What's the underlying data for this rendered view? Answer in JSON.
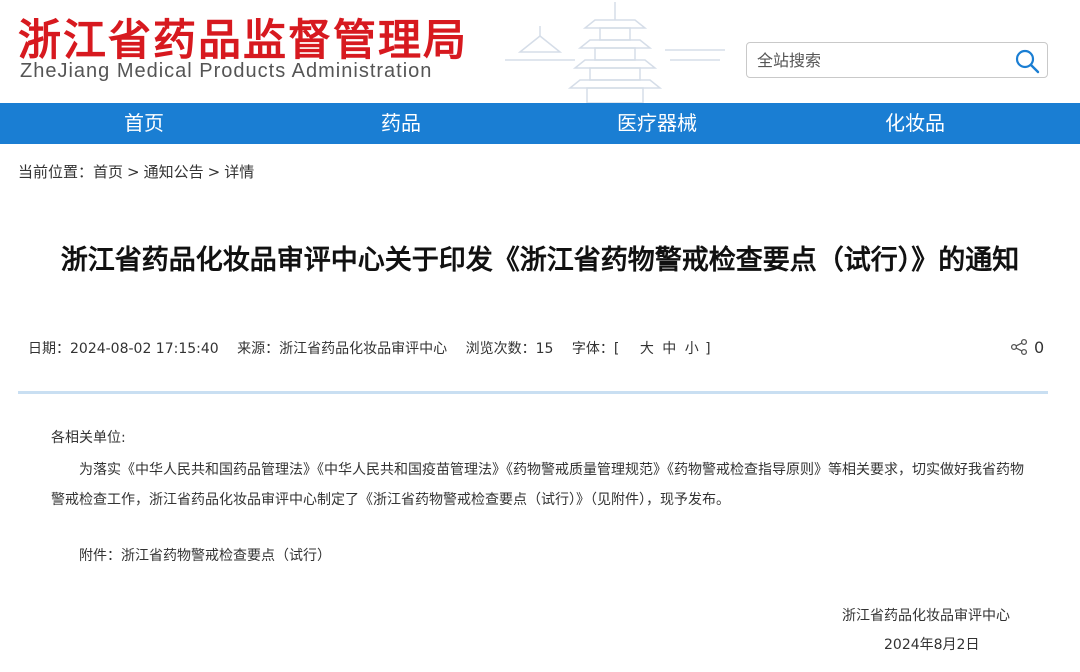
{
  "header": {
    "logo_cn": "浙江省药品监督管理局",
    "logo_en": "ZheJiang Medical Products Administration",
    "search_placeholder": "全站搜索"
  },
  "nav": {
    "items": [
      {
        "label": "首页"
      },
      {
        "label": "药品"
      },
      {
        "label": "医疗器械"
      },
      {
        "label": "化妆品"
      }
    ]
  },
  "breadcrumb": {
    "prefix": "当前位置：",
    "items": [
      "首页",
      "通知公告",
      "详情"
    ],
    "separator": ">"
  },
  "article": {
    "title": "浙江省药品化妆品审评中心关于印发《浙江省药物警戒检查要点（试行）》的通知",
    "meta": {
      "date": "日期：2024-08-02 17:15:40",
      "source": "来源：浙江省药品化妆品审评中心",
      "views": "浏览次数：15",
      "font_label": "字体：[",
      "font_large": "大",
      "font_medium": "中",
      "font_small": "小",
      "font_end": "]"
    },
    "share_count": "0",
    "salutation": "各相关单位:",
    "body": "为落实《中华人民共和国药品管理法》《中华人民共和国疫苗管理法》《药物警戒质量管理规范》《药物警戒检查指导原则》等相关要求，切实做好我省药物警戒检查工作，浙江省药品化妆品审评中心制定了《浙江省药物警戒检查要点（试行）》（见附件），现予发布。",
    "attachment_label": "附件：",
    "attachment_name": "浙江省药物警戒检查要点（试行）",
    "signer": "浙江省药品化妆品审评中心",
    "sign_date": "2024年8月2日"
  },
  "colors": {
    "brand_red": "#d7191f",
    "nav_blue": "#1a7ed3",
    "divider": "#c9dff2"
  }
}
